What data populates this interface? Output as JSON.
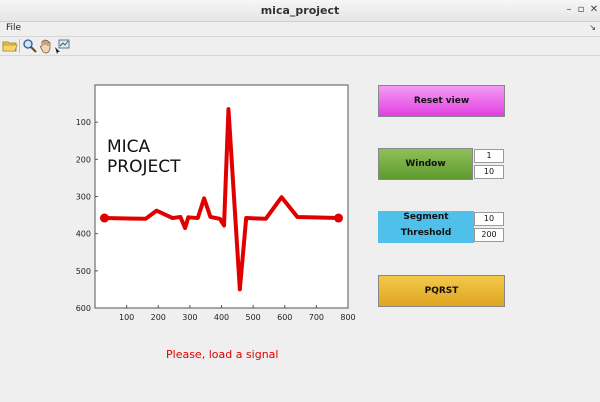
{
  "window": {
    "title": "mica_project",
    "minimize": "–",
    "maximize": "▫",
    "close": "✕"
  },
  "menubar": {
    "file": "File",
    "corner": "↘"
  },
  "toolbar": {
    "icons": [
      "open-folder-icon",
      "zoom-icon",
      "pan-hand-icon",
      "data-cursor-icon"
    ]
  },
  "controls": {
    "reset_view": "Reset view",
    "window_label": "Window",
    "window_values": [
      "1",
      "10"
    ],
    "segment_label": "Segment",
    "threshold_label": "Threshold",
    "segment_values": [
      "10",
      "200"
    ],
    "pqrst": "PQRST"
  },
  "status": "Please, load a signal",
  "colors": {
    "signal": "#e00000",
    "reset": "#e659e6",
    "window": "#6ea83a",
    "segment": "#4fc0ea",
    "pqrst": "#edb435"
  },
  "chart_data": {
    "type": "line",
    "annotation": [
      "MICA",
      "PROJECT"
    ],
    "xlim": [
      0,
      800
    ],
    "ylim": [
      600,
      0
    ],
    "y_axis_inverted": true,
    "xticks": [
      100,
      200,
      300,
      400,
      500,
      600,
      700,
      800
    ],
    "yticks": [
      100,
      200,
      300,
      400,
      500,
      600
    ],
    "series": [
      {
        "x": [
          30,
          160,
          195,
          245,
          270,
          285,
          295,
          325,
          345,
          365,
          395,
          408,
          422,
          458,
          478,
          540,
          590,
          640,
          770
        ],
        "y": [
          358,
          360,
          338,
          358,
          355,
          385,
          356,
          358,
          305,
          355,
          360,
          378,
          65,
          550,
          358,
          360,
          302,
          355,
          358
        ],
        "markers": [
          [
            30,
            358
          ],
          [
            770,
            358
          ]
        ]
      }
    ]
  }
}
